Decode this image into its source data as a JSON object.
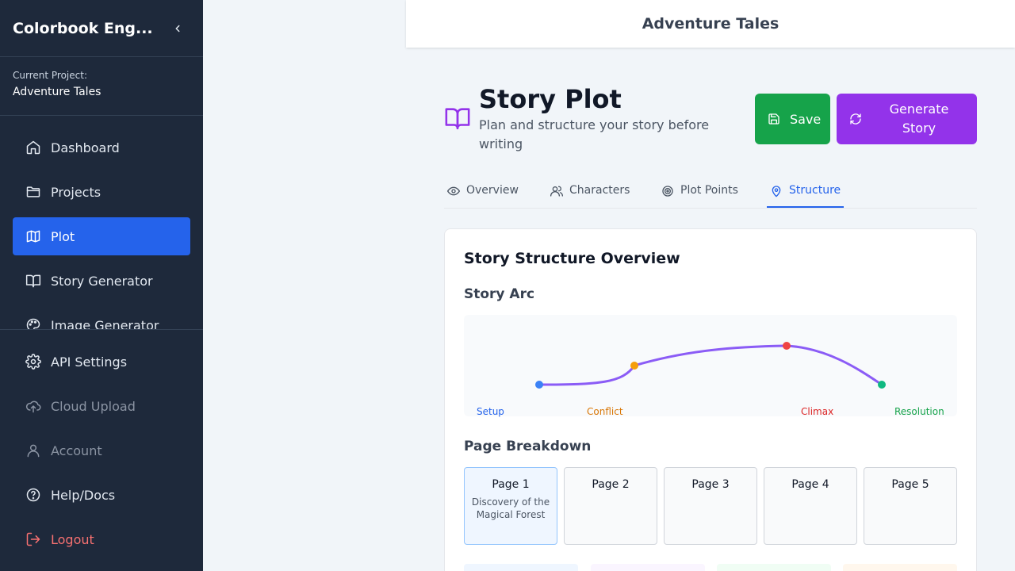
{
  "app": {
    "name": "Colorbook Eng..."
  },
  "project": {
    "label": "Current Project:",
    "name": "Adventure Tales"
  },
  "nav": {
    "main": [
      {
        "label": "Dashboard",
        "icon": "home-icon"
      },
      {
        "label": "Projects",
        "icon": "folder-icon"
      },
      {
        "label": "Plot",
        "icon": "map-icon",
        "active": true
      },
      {
        "label": "Story Generator",
        "icon": "book-icon"
      },
      {
        "label": "Image Generator",
        "icon": "palette-icon"
      }
    ],
    "bottom": [
      {
        "label": "API Settings",
        "icon": "gear-icon"
      },
      {
        "label": "Cloud Upload",
        "icon": "cloud-upload-icon",
        "disabled": true
      },
      {
        "label": "Account",
        "icon": "user-icon",
        "disabled": true
      },
      {
        "label": "Help/Docs",
        "icon": "help-icon"
      },
      {
        "label": "Logout",
        "icon": "logout-icon"
      }
    ]
  },
  "header": {
    "title": "Adventure Tales"
  },
  "page": {
    "title": "Story Plot",
    "subtitle": "Plan and structure your story before writing",
    "save_label": "Save",
    "generate_label": "Generate Story"
  },
  "tabs": [
    {
      "label": "Overview",
      "icon": "eye-icon"
    },
    {
      "label": "Characters",
      "icon": "users-icon"
    },
    {
      "label": "Plot Points",
      "icon": "target-icon"
    },
    {
      "label": "Structure",
      "icon": "map-pin-icon",
      "active": true
    }
  ],
  "structure": {
    "title": "Story Structure Overview",
    "arc_title": "Story Arc",
    "arc_labels": [
      {
        "label": "Setup",
        "color": "#2563eb"
      },
      {
        "label": "Conflict",
        "color": "#d97706"
      },
      {
        "label": "Climax",
        "color": "#dc2626"
      },
      {
        "label": "Resolution",
        "color": "#16a34a"
      }
    ],
    "arc_line_color": "#8b5cf6",
    "breakdown_title": "Page Breakdown",
    "pages": [
      {
        "label": "Page 1",
        "desc": "Discovery of the Magical Forest",
        "active": true
      },
      {
        "label": "Page 2",
        "desc": ""
      },
      {
        "label": "Page 3",
        "desc": ""
      },
      {
        "label": "Page 4",
        "desc": ""
      },
      {
        "label": "Page 5",
        "desc": ""
      }
    ]
  },
  "colors": {
    "sidebar_bg": "#1e293b",
    "active_nav": "#2563eb",
    "save": "#16a34a",
    "generate": "#9333ea",
    "accent_icon": "#9333ea",
    "logout": "#f87171"
  }
}
